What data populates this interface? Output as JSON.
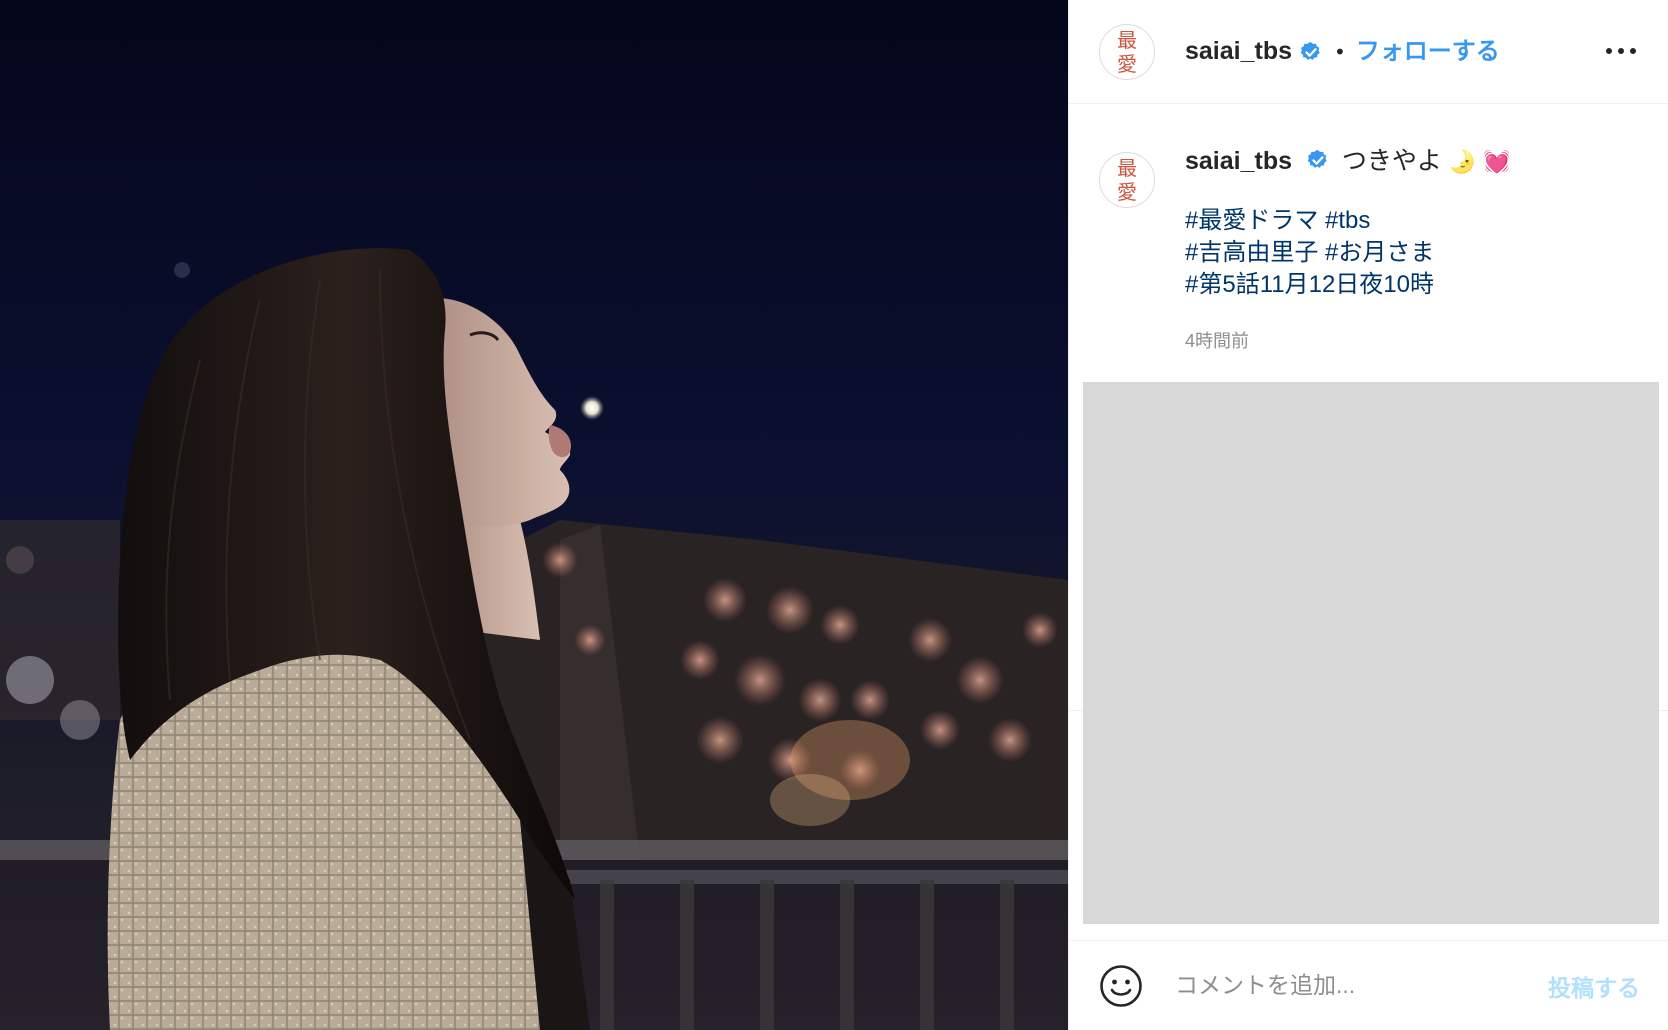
{
  "photo": {
    "alt": "",
    "sky_color": "#06091a"
  },
  "header": {
    "avatar_chars": [
      "最",
      "愛"
    ],
    "username": "saiai_tbs",
    "separator": "•",
    "follow_label": "フォローする",
    "more_icon": "more-horizontal-icon"
  },
  "caption": {
    "avatar_chars": [
      "最",
      "愛"
    ],
    "username": "saiai_tbs",
    "text": "つきやよ",
    "emoji_moon": "🌛",
    "emoji_heart": "💓",
    "hashtag_lines": [
      [
        "#最愛ドラマ",
        "#tbs"
      ],
      [
        "#吉高由里子",
        "#お月さま"
      ],
      [
        "#第5話11月12日夜10時"
      ]
    ],
    "timestamp": "4時間前"
  },
  "comment": {
    "emoji_icon": "smiley-icon",
    "placeholder": "コメントを追加...",
    "post_label": "投稿する"
  },
  "colors": {
    "link_blue": "#3897f0",
    "hashtag": "#003569",
    "post_disabled": "#b2dffc",
    "avatar_text": "#c9593f",
    "placeholder_gray": "#d8d8d8"
  }
}
